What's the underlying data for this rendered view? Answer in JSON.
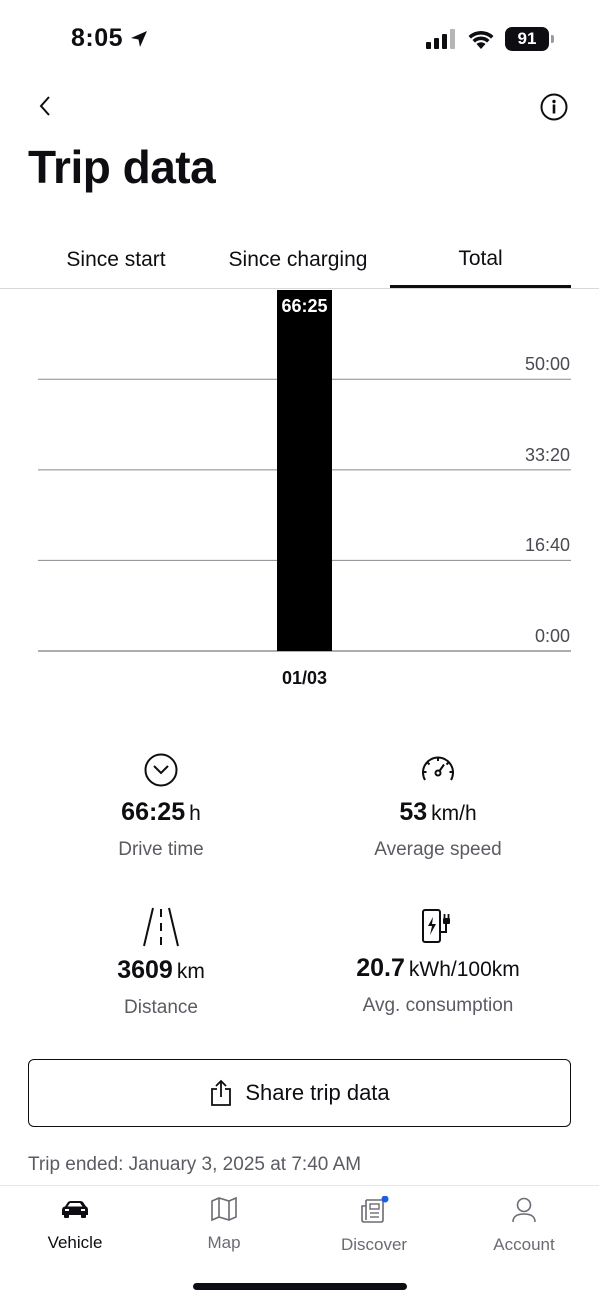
{
  "status": {
    "time": "8:05",
    "battery": "91"
  },
  "header": {
    "title": "Trip data"
  },
  "tabs": [
    {
      "label": "Since start"
    },
    {
      "label": "Since charging"
    },
    {
      "label": "Total"
    }
  ],
  "active_tab": "Total",
  "chart_data": {
    "type": "bar",
    "categories": [
      "01/03"
    ],
    "values": [
      "66:25"
    ],
    "values_minutes": [
      3985
    ],
    "y_ticks": [
      "0:00",
      "16:40",
      "33:20",
      "50:00"
    ],
    "y_ticks_minutes": [
      0,
      1000,
      2000,
      3000
    ],
    "ylim_minutes": [
      0,
      3985
    ],
    "data_labels": [
      "66:25"
    ],
    "grid": true,
    "bar_color": "#000000"
  },
  "stats": {
    "drive_time": {
      "value": "66:25",
      "unit": "h",
      "label": "Drive time",
      "icon": "clock-icon"
    },
    "average_speed": {
      "value": "53",
      "unit": "km/h",
      "label": "Average speed",
      "icon": "speedometer-icon"
    },
    "distance": {
      "value": "3609",
      "unit": "km",
      "label": "Distance",
      "icon": "road-icon"
    },
    "avg_consumption": {
      "value": "20.7",
      "unit": "kWh/100km",
      "label": "Avg. consumption",
      "icon": "charging-station-icon"
    }
  },
  "share_button": {
    "label": "Share trip data",
    "icon": "share-icon"
  },
  "trip_ended": "Trip ended: January 3, 2025 at 7:40 AM",
  "bottom_nav": [
    {
      "label": "Vehicle",
      "icon": "car-icon",
      "active": true
    },
    {
      "label": "Map",
      "icon": "map-icon",
      "active": false
    },
    {
      "label": "Discover",
      "icon": "newspaper-icon",
      "active": false,
      "badge": true
    },
    {
      "label": "Account",
      "icon": "person-icon",
      "active": false
    }
  ],
  "colors": {
    "text": "#0e0e12",
    "muted": "#5b5b63",
    "badge": "#1a5de6",
    "divider": "#d8d8da"
  }
}
